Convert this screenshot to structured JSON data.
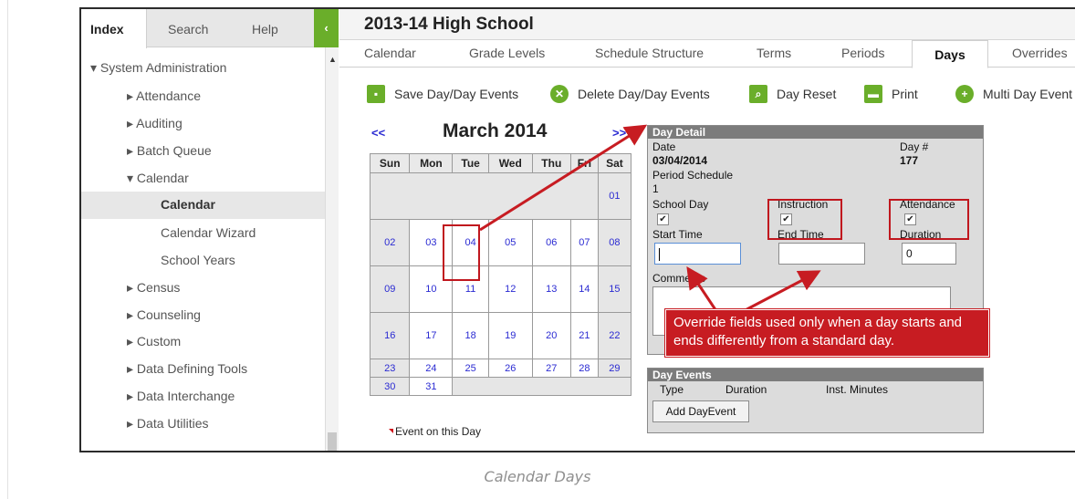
{
  "left_tabs": [
    "Index",
    "Search",
    "Help"
  ],
  "collapse_icon": "‹",
  "tree": {
    "root": "▾ System Administration",
    "items": [
      {
        "label": "▸ Attendance"
      },
      {
        "label": "▸ Auditing"
      },
      {
        "label": "▸ Batch Queue"
      },
      {
        "label": "▾ Calendar"
      },
      {
        "label": "Calendar"
      },
      {
        "label": "Calendar Wizard"
      },
      {
        "label": "School Years"
      },
      {
        "label": "▸ Census"
      },
      {
        "label": "▸ Counseling"
      },
      {
        "label": "▸ Custom"
      },
      {
        "label": "▸ Data Defining Tools"
      },
      {
        "label": "▸ Data Interchange"
      },
      {
        "label": "▸ Data Utilities"
      }
    ]
  },
  "scroll_up": "▲",
  "header": {
    "title": "2013-14 High School"
  },
  "subtabs": [
    "Calendar",
    "Grade Levels",
    "Schedule Structure",
    "Terms",
    "Periods",
    "Days",
    "Overrides"
  ],
  "toolbar": {
    "save": "Save Day/Day Events",
    "delete": "Delete Day/Day Events",
    "reset": "Day Reset",
    "print": "Print",
    "multi": "Multi Day Event"
  },
  "calendar": {
    "prev": "<<",
    "next": ">>",
    "month": "March 2014",
    "weekdays": [
      "Sun",
      "Mon",
      "Tue",
      "Wed",
      "Thu",
      "Fri",
      "Sat"
    ],
    "weeks": [
      [
        "",
        "",
        "",
        "",
        "",
        "",
        "01"
      ],
      [
        "02",
        "03",
        "04",
        "05",
        "06",
        "07",
        "08"
      ],
      [
        "09",
        "10",
        "11",
        "12",
        "13",
        "14",
        "15"
      ],
      [
        "16",
        "17",
        "18",
        "19",
        "20",
        "21",
        "22"
      ],
      [
        "23",
        "24",
        "25",
        "26",
        "27",
        "28",
        "29"
      ],
      [
        "30",
        "31",
        "",
        "",
        "",
        "",
        ""
      ]
    ],
    "legend": "Event on this Day"
  },
  "day_detail": {
    "header": "Day Detail",
    "date_label": "Date",
    "date_value": "03/04/2014",
    "daynum_label": "Day #",
    "daynum_value": "177",
    "period_label": "Period Schedule",
    "period_value": "1",
    "school_day_label": "School Day",
    "instruction_label": "Instruction",
    "attendance_label": "Attendance",
    "start_label": "Start Time",
    "end_label": "End Time",
    "duration_label": "Duration",
    "start_value": "",
    "end_value": "",
    "duration_value": "0",
    "comments_label": "Comments"
  },
  "day_events": {
    "header": "Day Events",
    "col_type": "Type",
    "col_duration": "Duration",
    "col_minutes": "Inst. Minutes",
    "add_button": "Add DayEvent"
  },
  "callout": "Override fields used only when a day starts and ends differently from a standard day.",
  "caption": "Calendar Days",
  "colors": {
    "accent": "#6aae2a",
    "annotation": "#c71c22",
    "link": "#2a2ad2"
  }
}
